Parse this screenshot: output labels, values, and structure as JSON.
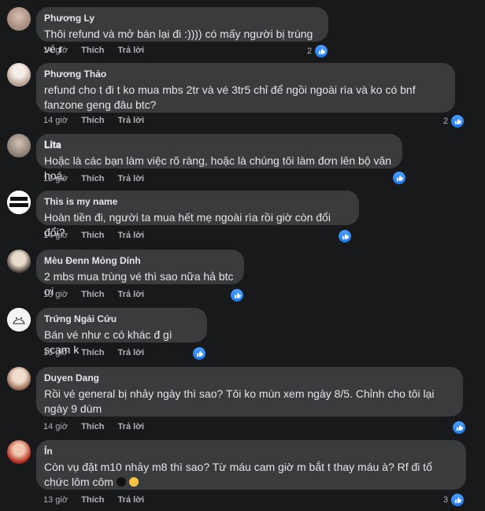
{
  "comments": [
    {
      "name": "Phương Ly",
      "text": "Thôi refund và mở bán lại đi :)))) có mấy người bị trùng vé r",
      "time": "14 giờ",
      "like": "Thích",
      "reply": "Trả lời",
      "reactions": "2",
      "avatar_color": "#c9b0a0"
    },
    {
      "name": "Phương Thảo",
      "text": "refund cho t đi t ko mua mbs 2tr và vé 3tr5 chỉ để ngồi ngoài rìa và ko có bnf fanzone geng đâu btc?",
      "time": "14 giờ",
      "like": "Thích",
      "reply": "Trả lời",
      "reactions": "2",
      "avatar_color": "#e8e2dc"
    },
    {
      "name": "𝐋𝐢𝐭𝐚",
      "text": "Hoặc là các bạn làm việc rõ ràng, hoặc là chúng tôi làm đơn lên bộ văn hoá.",
      "time": "12 giờ",
      "like": "Thích",
      "reply": "Trả lời",
      "reactions": "",
      "avatar_color": "#a89a90"
    },
    {
      "name": "This is my name",
      "text": "Hoàn tiền đi, người ta mua hết mẹ ngoài rìa rồi giờ còn đổi đổi?",
      "time": "14 giờ",
      "like": "Thích",
      "reply": "Trả lời",
      "reactions": "",
      "avatar_color": "#ffffff"
    },
    {
      "name": "Mèu Đenn Mỏng Dính",
      "text": "2 mbs mua trùng vé thì sao nữa hả btc ơi",
      "time": "13 giờ",
      "like": "Thích",
      "reply": "Trả lời",
      "reactions": "",
      "avatar_color": "#7a6a5e"
    },
    {
      "name": "Trứng Ngải Cứu",
      "text": "Bán vé như c có khác đ gì scam k",
      "time": "13 giờ",
      "like": "Thích",
      "reply": "Trả lời",
      "reactions": "",
      "avatar_color": "#f2f2f2"
    },
    {
      "name": "Duyen Dang",
      "text": "Rồi vé general bị nhảy ngày thì sao? Tôi ko mún xem ngày 8/5. Chỉnh cho tôi lại ngày 9 dùm",
      "time": "14 giờ",
      "like": "Thích",
      "reply": "Trả lời",
      "reactions": "",
      "avatar_color": "#d8b8a0"
    },
    {
      "name": "Ỉn",
      "text": "Còn vụ đặt m10 nhảy m8 thì sao? Từ máu cam giờ m bắt t thay máu à? Rf đi tổ chức lôm côm",
      "time": "13 giờ",
      "like": "Thích",
      "reply": "Trả lời",
      "reactions": "3",
      "avatar_color": "#c04030"
    }
  ]
}
